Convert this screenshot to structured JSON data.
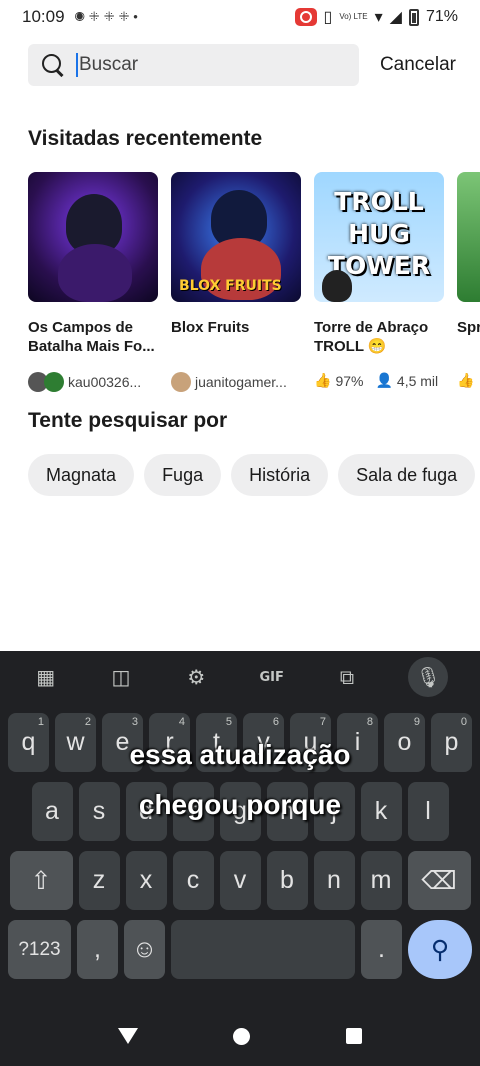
{
  "status": {
    "time": "10:09",
    "network": "Vo) LTE",
    "battery": "71%"
  },
  "search": {
    "placeholder": "Buscar",
    "value": "",
    "cancel_label": "Cancelar"
  },
  "recent": {
    "title": "Visitadas recentemente",
    "games": [
      {
        "title": "Os Campos de Batalha Mais Fo...",
        "meta": "kau00326..."
      },
      {
        "title": "Blox Fruits",
        "meta": "juanitogamer...",
        "logo": "BLOX FRUITS"
      },
      {
        "title": "Torre de Abraço TROLL 😁",
        "rating": "97%",
        "players": "4,5 mil",
        "thumb_text": [
          "TROLL",
          "HUG",
          "TOWER"
        ]
      },
      {
        "title": "Spr"
      }
    ]
  },
  "try": {
    "title": "Tente pesquisar por",
    "chips": [
      "Magnata",
      "Fuga",
      "História",
      "Sala de fuga"
    ]
  },
  "keyboard": {
    "gif_label": "GIF",
    "row1": [
      {
        "k": "q",
        "n": "1"
      },
      {
        "k": "w",
        "n": "2"
      },
      {
        "k": "e",
        "n": "3"
      },
      {
        "k": "r",
        "n": "4"
      },
      {
        "k": "t",
        "n": "5"
      },
      {
        "k": "y",
        "n": "6"
      },
      {
        "k": "u",
        "n": "7"
      },
      {
        "k": "i",
        "n": "8"
      },
      {
        "k": "o",
        "n": "9"
      },
      {
        "k": "p",
        "n": "0"
      }
    ],
    "row2": [
      "a",
      "s",
      "d",
      "f",
      "g",
      "h",
      "j",
      "k",
      "l"
    ],
    "row3": [
      "z",
      "x",
      "c",
      "v",
      "b",
      "n",
      "m"
    ],
    "symbols_label": "?123",
    "comma": ",",
    "period": ".",
    "emoji": "☺"
  },
  "overlay": {
    "line1": "essa atualização",
    "line2": "chegou porque"
  }
}
